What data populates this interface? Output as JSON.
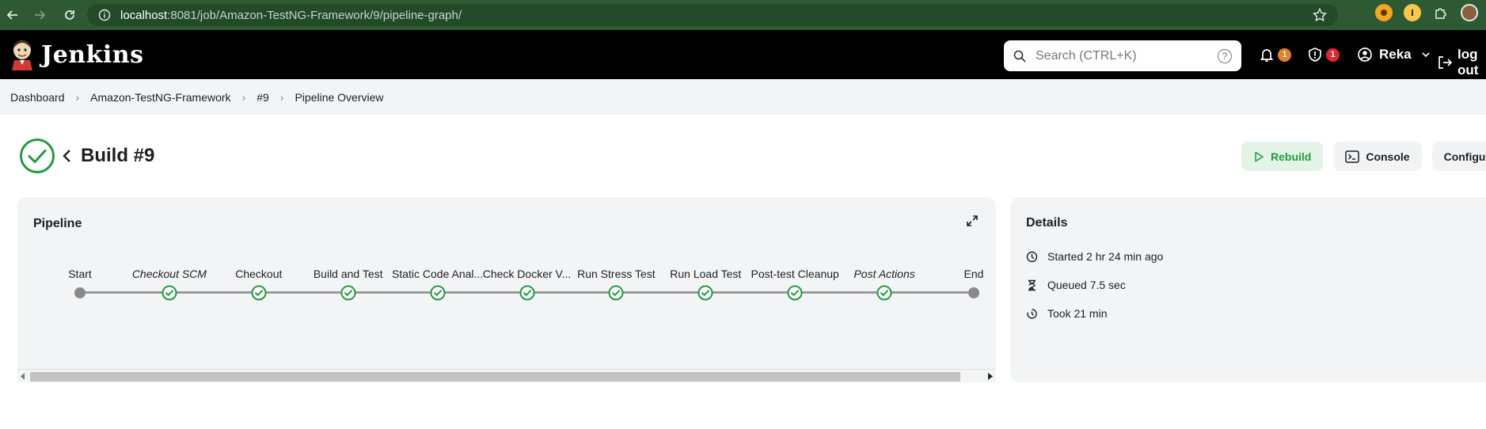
{
  "browser": {
    "url_host": "localhost",
    "url_path": ":8081/job/Amazon-TestNG-Framework/9/pipeline-graph/"
  },
  "header": {
    "brand": "Jenkins",
    "search_placeholder": "Search (CTRL+K)",
    "help_symbol": "?",
    "notifications_count": "1",
    "security_count": "1",
    "user_name": "Reka",
    "logout_label": "log out"
  },
  "breadcrumb": [
    "Dashboard",
    "Amazon-TestNG-Framework",
    "#9",
    "Pipeline Overview"
  ],
  "build": {
    "title": "Build #9",
    "status": "success"
  },
  "actions": {
    "rebuild": "Rebuild",
    "console": "Console",
    "configure": "Configure"
  },
  "pipeline": {
    "title": "Pipeline",
    "stages": [
      {
        "label": "Start",
        "status": "marker",
        "italic": false
      },
      {
        "label": "Checkout SCM",
        "status": "success",
        "italic": true
      },
      {
        "label": "Checkout",
        "status": "success",
        "italic": false
      },
      {
        "label": "Build and Test",
        "status": "success",
        "italic": false
      },
      {
        "label": "Static Code Anal...",
        "status": "success",
        "italic": false
      },
      {
        "label": "Check Docker V...",
        "status": "success",
        "italic": false
      },
      {
        "label": "Run Stress Test",
        "status": "success",
        "italic": false
      },
      {
        "label": "Run Load Test",
        "status": "success",
        "italic": false
      },
      {
        "label": "Post-test Cleanup",
        "status": "success",
        "italic": false
      },
      {
        "label": "Post Actions",
        "status": "success",
        "italic": true
      },
      {
        "label": "End",
        "status": "marker",
        "italic": false
      }
    ]
  },
  "details": {
    "title": "Details",
    "started": "Started 2 hr 24 min ago",
    "queued": "Queued 7.5 sec",
    "took": "Took 21 min"
  },
  "colors": {
    "success": "#1f9b40",
    "badge_orange": "#e67e22",
    "badge_red": "#e0262f",
    "chrome_green": "#2d5a33"
  }
}
